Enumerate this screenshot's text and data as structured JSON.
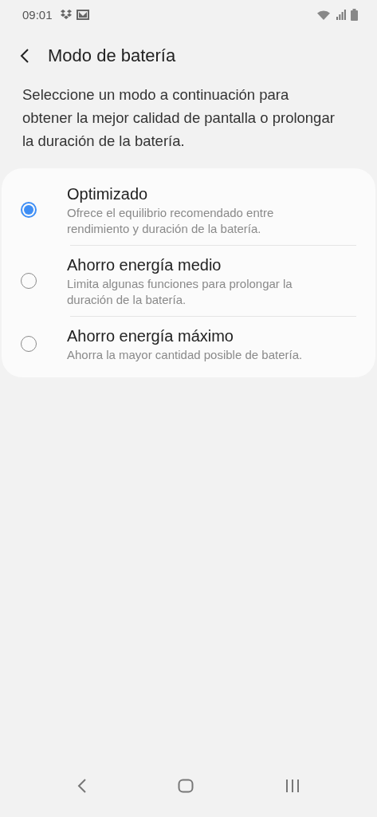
{
  "status_bar": {
    "time": "09:01"
  },
  "header": {
    "title": "Modo de batería"
  },
  "description": "Seleccione un modo a continuación para obtener la mejor calidad de pantalla o prolongar la duración de la batería.",
  "options": [
    {
      "title": "Optimizado",
      "subtitle": "Ofrece el equilibrio recomendado entre rendimiento y duración de la batería.",
      "selected": true
    },
    {
      "title": "Ahorro energía medio",
      "subtitle": "Limita algunas funciones para prolongar la duración de la batería.",
      "selected": false
    },
    {
      "title": "Ahorro energía máximo",
      "subtitle": "Ahorra la mayor cantidad posible de batería.",
      "selected": false
    }
  ]
}
